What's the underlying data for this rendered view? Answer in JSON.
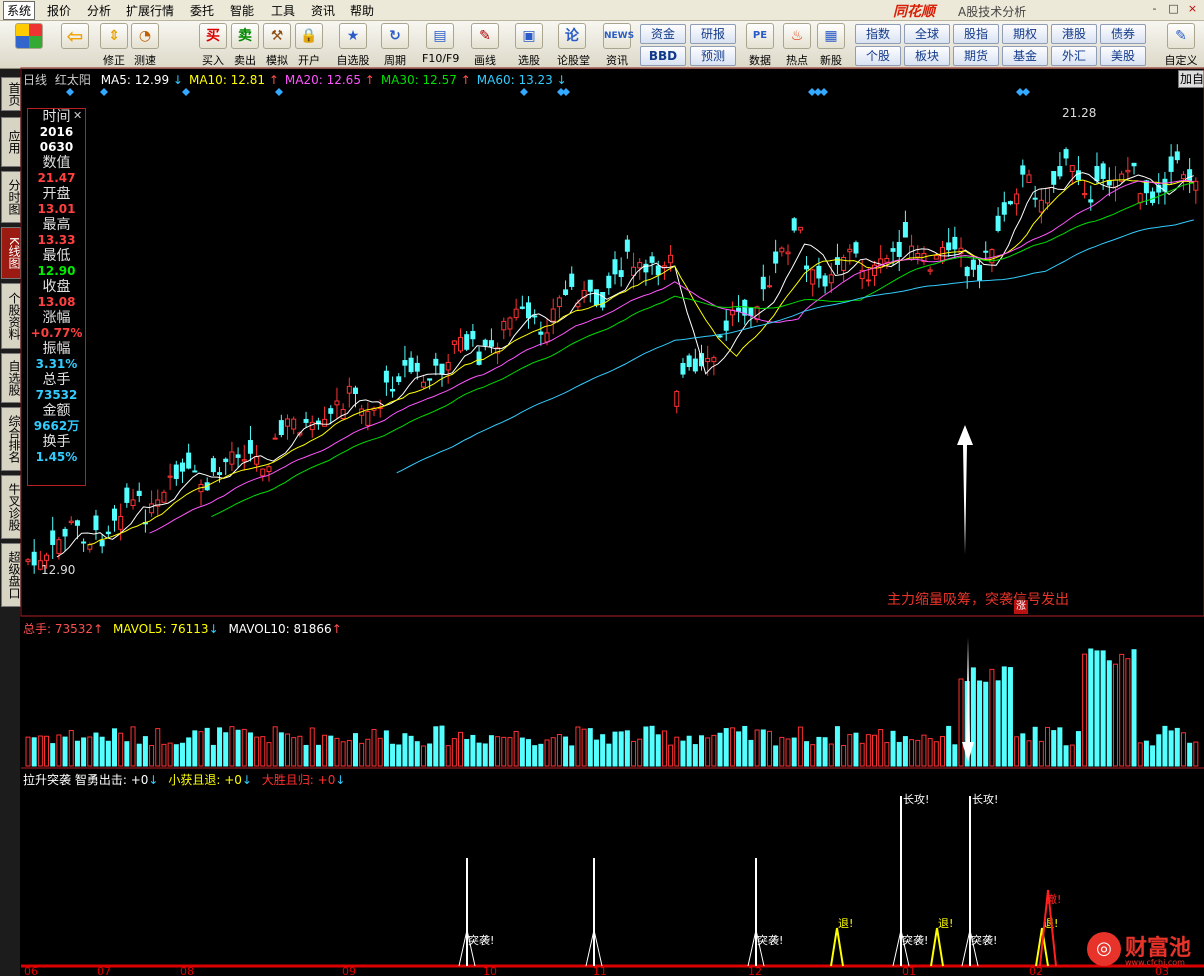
{
  "menu": {
    "items": [
      "系统",
      "报价",
      "分析",
      "扩展行情",
      "委托",
      "智能",
      "工具",
      "资讯",
      "帮助"
    ],
    "brand": "同花顺",
    "brand_sub": "A股技术分析",
    "window_controls": [
      "-",
      "□",
      "×"
    ]
  },
  "toolbar": {
    "buttons": [
      {
        "label": "",
        "icon": "grid-icon"
      },
      {
        "label": "",
        "icon": "back-arrow-icon"
      },
      {
        "label": "修正",
        "icon": "up-down-arrow-icon"
      },
      {
        "label": "测速",
        "icon": "clock-icon"
      },
      {
        "label": "买入",
        "icon": "buy-icon",
        "glyph": "买"
      },
      {
        "label": "卖出",
        "icon": "sell-icon",
        "glyph": "卖"
      },
      {
        "label": "模拟",
        "icon": "hammer-icon"
      },
      {
        "label": "开户",
        "icon": "lock-icon"
      },
      {
        "label": "自选股",
        "icon": "star-icon"
      },
      {
        "label": "周期",
        "icon": "cycle-icon"
      },
      {
        "label": "F10/F9",
        "icon": "f10-icon"
      },
      {
        "label": "画线",
        "icon": "pencil-icon"
      },
      {
        "label": "选股",
        "icon": "screen-icon"
      },
      {
        "label": "论股堂",
        "icon": "forum-icon"
      },
      {
        "label": "资讯",
        "icon": "news-icon",
        "glyph": "NEWS"
      },
      {
        "label": "数据",
        "icon": "pe-icon",
        "glyph": "PE"
      },
      {
        "label": "热点",
        "icon": "hot-icon"
      },
      {
        "label": "新股",
        "icon": "ipo-icon"
      },
      {
        "label": "自定义",
        "icon": "custom-icon"
      }
    ],
    "grid_buttons_left": [
      [
        "资金",
        "研报"
      ],
      [
        "BBD",
        "预测"
      ]
    ],
    "grid_buttons_right": [
      [
        "指数",
        "全球",
        "股指",
        "期权",
        "港股",
        "债券"
      ],
      [
        "个股",
        "板块",
        "期货",
        "基金",
        "外汇",
        "美股"
      ]
    ]
  },
  "sidetabs": [
    "首页",
    "应用",
    "分时图",
    "K线图",
    "个股资料",
    "自选股",
    "综合排名",
    "牛叉诊股",
    "超级盘口"
  ],
  "kline": {
    "period": "日线",
    "pattern": "红太阳",
    "ma": [
      {
        "name": "MA5",
        "value": "12.99",
        "dir": "↓",
        "color": "#ffffff"
      },
      {
        "name": "MA10",
        "value": "12.81",
        "dir": "↑",
        "color": "#ffff00"
      },
      {
        "name": "MA20",
        "value": "12.65",
        "dir": "↑",
        "color": "#ff55ff"
      },
      {
        "name": "MA30",
        "value": "12.57",
        "dir": "↑",
        "color": "#00dd00"
      },
      {
        "name": "MA60",
        "value": "13.23",
        "dir": "↓",
        "color": "#33ccff"
      }
    ],
    "add_button": "加自",
    "high_label": "21.28",
    "low_label": "12.90",
    "annotation": "主力缩量吸筹，突袭信号发出",
    "annotation_tag": "涨"
  },
  "infobox": [
    {
      "k": "时间",
      "v": "2016",
      "c": "#ffffff"
    },
    {
      "k": "",
      "v": "0630",
      "c": "#ffffff"
    },
    {
      "k": "数值",
      "v": "21.47",
      "c": "#ff4040"
    },
    {
      "k": "开盘",
      "v": "13.01",
      "c": "#ff4040"
    },
    {
      "k": "最高",
      "v": "13.33",
      "c": "#ff4040"
    },
    {
      "k": "最低",
      "v": "12.90",
      "c": "#00ee00"
    },
    {
      "k": "收盘",
      "v": "13.08",
      "c": "#ff4040"
    },
    {
      "k": "涨幅",
      "v": "+0.77%",
      "c": "#ff4040"
    },
    {
      "k": "振幅",
      "v": "3.31%",
      "c": "#33ccff"
    },
    {
      "k": "总手",
      "v": "73532",
      "c": "#33ccff"
    },
    {
      "k": "金额",
      "v": "9662万",
      "c": "#33ccff"
    },
    {
      "k": "换手",
      "v": "1.45%",
      "c": "#33ccff"
    }
  ],
  "volume": {
    "label": "总手",
    "value": "73532",
    "dir": "↑",
    "mav5_label": "MAVOL5",
    "mav5": "76113",
    "mav5_dir": "↓",
    "mav10_label": "MAVOL10",
    "mav10": "81866",
    "mav10_dir": "↑"
  },
  "signals": {
    "name": "拉升突袭",
    "items": [
      {
        "label": "智勇出击",
        "value": "+0",
        "dir": "↓",
        "color": "#ffffff"
      },
      {
        "label": "小获且退",
        "value": "+0",
        "dir": "↓",
        "color": "#ffff00"
      },
      {
        "label": "大胜且归",
        "value": "+0",
        "dir": "↓",
        "color": "#ff3030"
      }
    ],
    "texts": {
      "raid": "突袭!",
      "retreat": "退!",
      "long": "长攻!",
      "home": "撤!"
    }
  },
  "x_axis": [
    "06",
    "07",
    "08",
    "09",
    "10",
    "11",
    "12",
    "01",
    "02",
    "03"
  ],
  "watermark": "财富池",
  "watermark_url": "www.cfchi.com"
}
